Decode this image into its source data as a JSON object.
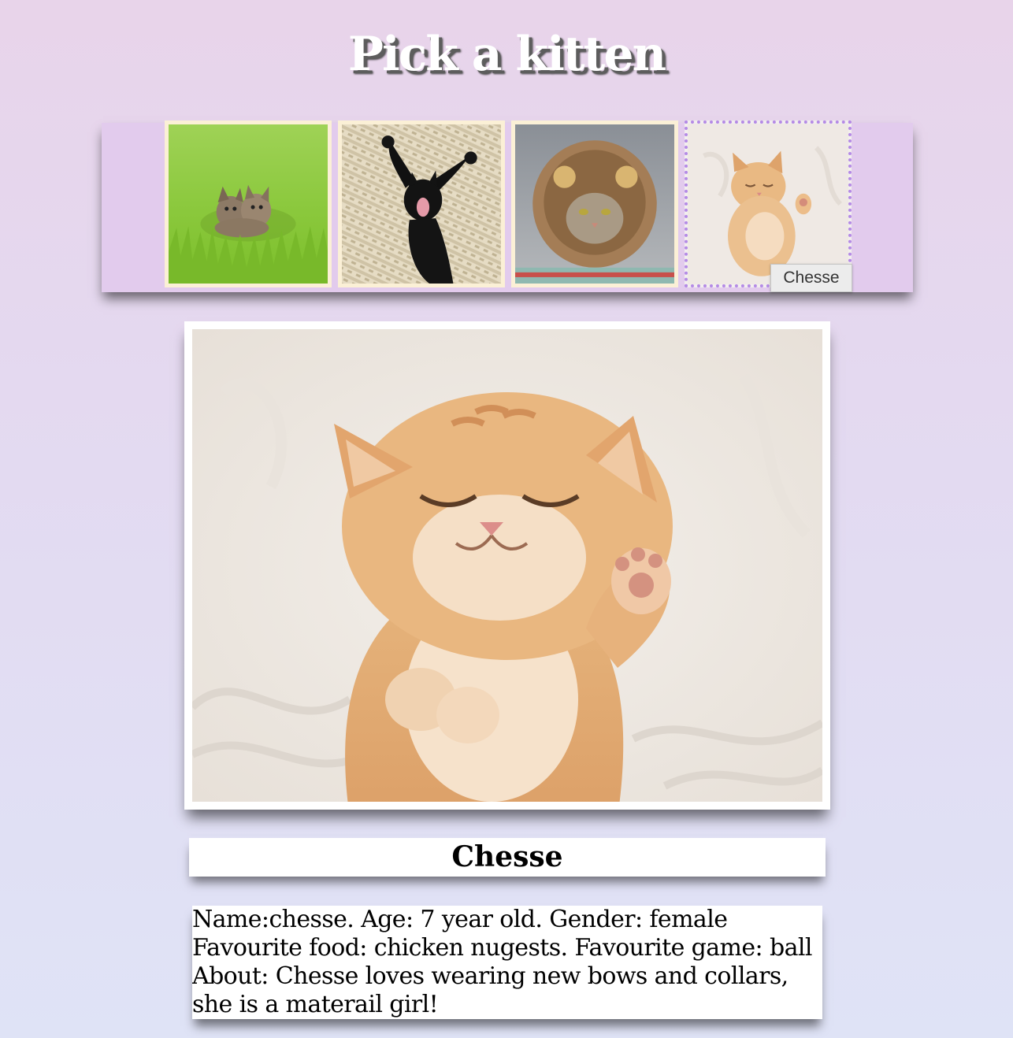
{
  "page": {
    "title": "Pick a kitten"
  },
  "gallery": {
    "thumbnails": [
      {
        "label": "two kittens in grass"
      },
      {
        "label": "black kitten yawning"
      },
      {
        "label": "cat in lion mane"
      },
      {
        "label": "ginger kitten sleeping",
        "selected": true
      }
    ],
    "tooltip": "Chesse"
  },
  "selected_kitten": {
    "name": "Chesse",
    "description": "Name:chesse. Age: 7 year old. Gender: female Favourite food: chicken nugests. Favourite game: ball About: Chesse loves wearing new bows and collars, she is a materail girl!"
  },
  "colors": {
    "background_top": "#e8d4ea",
    "background_bottom": "#dfe3f6",
    "strip": "#e2cbed",
    "thumb_border": "#fbf0d6",
    "selected_border": "#b48ae6"
  }
}
